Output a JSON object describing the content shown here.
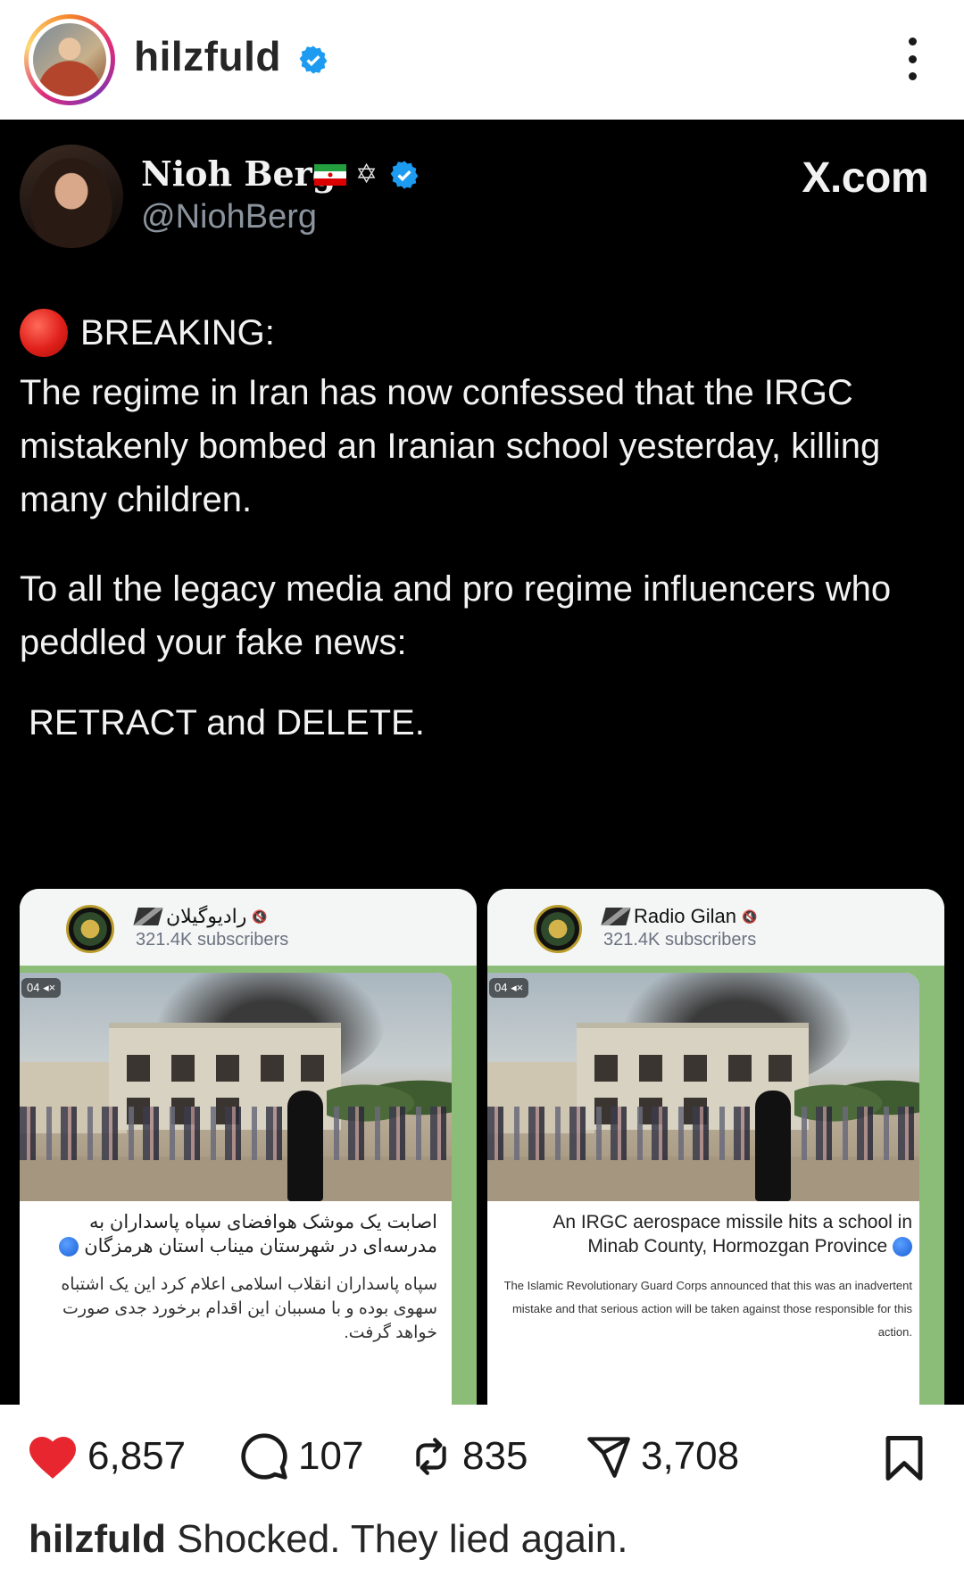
{
  "header": {
    "username": "hilzfuld"
  },
  "tweet": {
    "name": "Nioh Berg",
    "handle": "@NiohBerg",
    "site": "X.com",
    "breaking": "BREAKING:",
    "paragraph1": "The regime in Iran has now confessed that the IRGC mistakenly bombed an Iranian school yesterday, killing many children.",
    "paragraph2": "To all the legacy media and pro regime influencers who peddled your fake news:",
    "paragraph3": "RETRACT and DELETE."
  },
  "cards": {
    "left": {
      "channel": "راديوگيلان",
      "subscribers": "321.4K subscribers",
      "badge": "04 ◂×",
      "caption1": "اصابت یک موشک هوافضای سپاه پاسداران به مدرسه‌ای در شهرستان میناب استان هرمزگان",
      "caption2": "سپاه پاسداران انقلاب اسلامی اعلام کرد این یک اشتباه سهوی بوده و با مسببان این اقدام برخورد جدی صورت خواهد گرفت."
    },
    "right": {
      "channel": "Radio Gilan",
      "subscribers": "321.4K subscribers",
      "badge": "04 ◂×",
      "caption1": "An IRGC aerospace missile hits a school in Minab County, Hormozgan Province",
      "caption2": "The Islamic Revolutionary Guard Corps announced that this was an inadvertent mistake and that serious action will be taken against those responsible for this action."
    }
  },
  "actions": {
    "likes": "6,857",
    "comments": "107",
    "reposts": "835",
    "shares": "3,708"
  },
  "caption": {
    "username": "hilzfuld",
    "text": "Shocked. They lied again."
  },
  "colors": {
    "like": "#e8262f",
    "verified": "#1d9bf0",
    "breaking_dot": "#e0201a",
    "card_green": "#8cbd78"
  },
  "icons": [
    "verified-badge-icon",
    "more-options-icon",
    "iran-flag-icon",
    "star-of-david-icon",
    "heart-icon",
    "comment-icon",
    "repost-icon",
    "share-icon",
    "bookmark-icon"
  ]
}
